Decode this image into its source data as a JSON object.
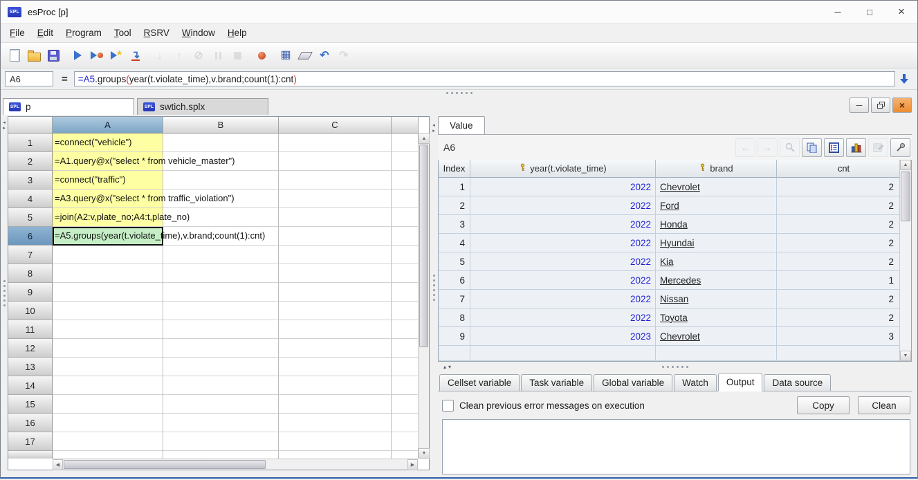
{
  "window": {
    "app_icon": "SPL",
    "title": "esProc  [p]",
    "controls": {
      "minimize": "─",
      "maximize": "□",
      "close": "×"
    }
  },
  "menu": {
    "items": [
      "File",
      "Edit",
      "Program",
      "Tool",
      "RSRV",
      "Window",
      "Help"
    ]
  },
  "toolbar": {
    "icons": [
      {
        "name": "new-file",
        "glyph": "doc",
        "enabled": true
      },
      {
        "name": "open-file",
        "glyph": "folder",
        "enabled": true
      },
      {
        "name": "save-file",
        "glyph": "floppy",
        "enabled": true
      },
      {
        "name": "run",
        "glyph": "play",
        "enabled": true
      },
      {
        "name": "debug-run",
        "glyph": "play-dot",
        "enabled": true
      },
      {
        "name": "step-execute",
        "glyph": "play-star",
        "enabled": true
      },
      {
        "name": "run-to-cursor",
        "glyph": "jump",
        "enabled": true
      },
      {
        "name": "step-into",
        "glyph": "arrow-down",
        "enabled": false
      },
      {
        "name": "step-return",
        "glyph": "arrow-up",
        "enabled": false
      },
      {
        "name": "cancel-run",
        "glyph": "no",
        "enabled": false
      },
      {
        "name": "pause",
        "glyph": "pause",
        "enabled": false
      },
      {
        "name": "stop",
        "glyph": "stop",
        "enabled": false
      },
      {
        "name": "breakpoint",
        "glyph": "dot",
        "enabled": true
      },
      {
        "name": "calculate",
        "glyph": "calc",
        "enabled": true
      },
      {
        "name": "clear-cells",
        "glyph": "eraser",
        "enabled": true
      },
      {
        "name": "undo",
        "glyph": "undo",
        "enabled": true
      },
      {
        "name": "redo",
        "glyph": "redo",
        "enabled": false
      }
    ]
  },
  "formula_bar": {
    "cell_ref": "A6",
    "equals": "=",
    "parts": [
      {
        "text": "=A5",
        "color": "#2424d6"
      },
      {
        "text": ".groups",
        "color": "#1a1a1a"
      },
      {
        "text": "(",
        "color": "#e02b2b"
      },
      {
        "text": "year(t.violate_time),v.brand;count(1):cnt",
        "color": "#1a1a1a"
      },
      {
        "text": ")",
        "color": "#e02b2b"
      }
    ]
  },
  "doc_tabs": [
    {
      "label": "p",
      "active": true
    },
    {
      "label": "swtich.splx",
      "active": false
    }
  ],
  "child_controls": {
    "minimize": "─",
    "close": "×"
  },
  "grid": {
    "columns": [
      "A",
      "B",
      "C"
    ],
    "selected_column": "A",
    "selected_row": 6,
    "row_count": 17,
    "cells": [
      {
        "row": 1,
        "text": "=connect(\"vehicle\")",
        "bg": "yellow"
      },
      {
        "row": 2,
        "text": "=A1.query@x(\"select * from vehicle_master\")",
        "bg": "yellow"
      },
      {
        "row": 3,
        "text": "=connect(\"traffic\")",
        "bg": "yellow"
      },
      {
        "row": 4,
        "text": "=A3.query@x(\"select * from traffic_violation\")",
        "bg": "yellow"
      },
      {
        "row": 5,
        "text": "=join(A2:v,plate_no;A4:t,plate_no)",
        "bg": "yellow"
      },
      {
        "row": 6,
        "text": "=A5.groups(year(t.violate_time),v.brand;count(1):cnt)",
        "bg": "green"
      }
    ],
    "colors": {
      "normal_cell": "#feffa2",
      "selected_cell": "#c6eec6",
      "selected_header": "#7da6c6"
    }
  },
  "value_panel": {
    "tab_label": "Value",
    "cell_ref": "A6",
    "buttons": [
      {
        "name": "prev",
        "glyph": "arrow-left",
        "enabled": false
      },
      {
        "name": "next",
        "glyph": "arrow-right",
        "enabled": false
      },
      {
        "name": "zoom-value",
        "glyph": "magnifier",
        "enabled": false
      },
      {
        "name": "copy-data",
        "glyph": "copy",
        "enabled": true
      },
      {
        "name": "form-view",
        "glyph": "form",
        "enabled": true
      },
      {
        "name": "draw-chart",
        "glyph": "chart",
        "enabled": true
      },
      {
        "name": "edit-value",
        "glyph": "sheet-edit",
        "enabled": false
      },
      {
        "name": "pin-window",
        "glyph": "pin",
        "enabled": true
      }
    ],
    "table": {
      "columns": [
        {
          "label": "Index",
          "key": false
        },
        {
          "label": "year(t.violate_time)",
          "key": true
        },
        {
          "label": "brand",
          "key": true
        },
        {
          "label": "cnt",
          "key": false
        }
      ],
      "rows": [
        [
          "1",
          "2022",
          "Chevrolet",
          "2"
        ],
        [
          "2",
          "2022",
          "Ford",
          "2"
        ],
        [
          "3",
          "2022",
          "Honda",
          "2"
        ],
        [
          "4",
          "2022",
          "Hyundai",
          "2"
        ],
        [
          "5",
          "2022",
          "Kia",
          "2"
        ],
        [
          "6",
          "2022",
          "Mercedes",
          "1"
        ],
        [
          "7",
          "2022",
          "Nissan",
          "2"
        ],
        [
          "8",
          "2022",
          "Toyota",
          "2"
        ],
        [
          "9",
          "2023",
          "Chevrolet",
          "3"
        ]
      ],
      "year_color": "#1f1fd0",
      "key_icon_color": "#c9a227"
    }
  },
  "bottom_tabs": [
    "Cellset variable",
    "Task variable",
    "Global variable",
    "Watch",
    "Output",
    "Data source"
  ],
  "active_bottom_tab": "Output",
  "output_panel": {
    "checkbox_label": "Clean previous error messages on execution",
    "checkbox_checked": false,
    "copy_label": "Copy",
    "clean_label": "Clean",
    "console_text": ""
  }
}
